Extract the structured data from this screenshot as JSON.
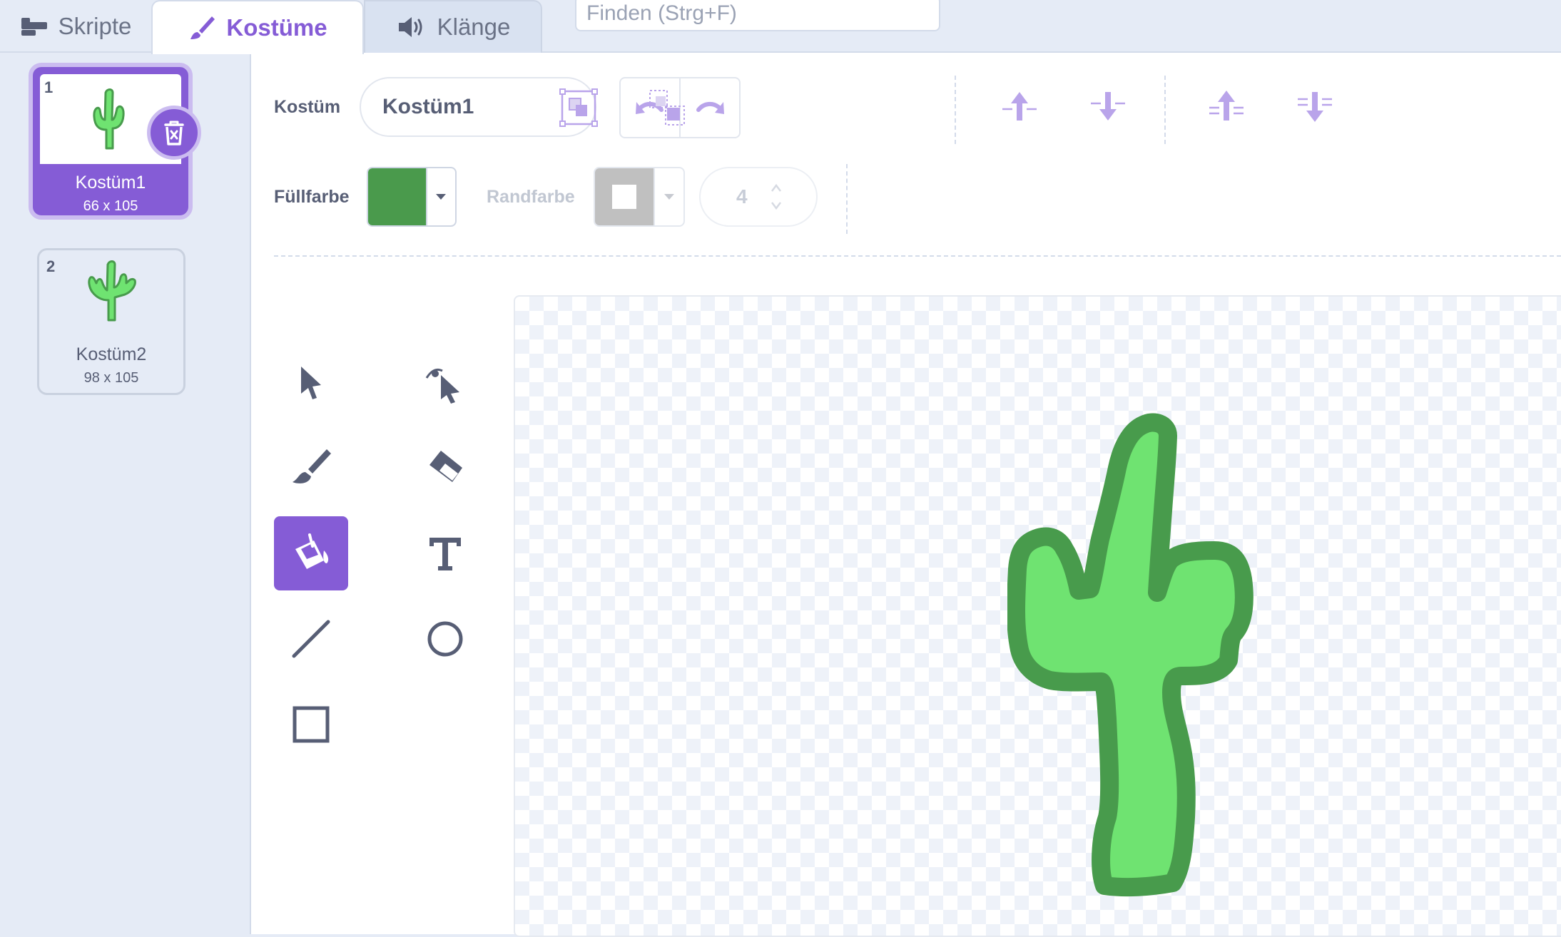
{
  "tabs": {
    "code": "Skripte",
    "costumes": "Kostüme",
    "sounds": "Klänge"
  },
  "search": {
    "placeholder": "Finden (Strg+F)"
  },
  "costumes": [
    {
      "number": "1",
      "name": "Kostüm1",
      "size": "66 x 105",
      "selected": true
    },
    {
      "number": "2",
      "name": "Kostüm2",
      "size": "98 x 105",
      "selected": false
    }
  ],
  "editor": {
    "costume_label": "Kostüm",
    "costume_name": "Kostüm1",
    "fill_label": "Füllfarbe",
    "fill_color": "#4a9a4c",
    "outline_label": "Randfarbe",
    "outline_width": "4",
    "selected_tool": "fill"
  },
  "colors": {
    "accent": "#855cd6",
    "cactus_fill": "#6fe371",
    "cactus_outline": "#489b4c"
  },
  "icons": {
    "undo": "undo-icon",
    "redo": "redo-icon",
    "group": "group-icon",
    "ungroup": "ungroup-icon",
    "forward": "forward-icon",
    "backward": "backward-icon",
    "front": "front-icon",
    "back": "back-icon",
    "select": "select-icon",
    "reshape": "reshape-icon",
    "brush": "brush-icon",
    "eraser": "eraser-icon",
    "fill": "fill-icon",
    "text": "text-icon",
    "line": "line-icon",
    "circle": "circle-icon",
    "rect": "rectangle-icon"
  }
}
